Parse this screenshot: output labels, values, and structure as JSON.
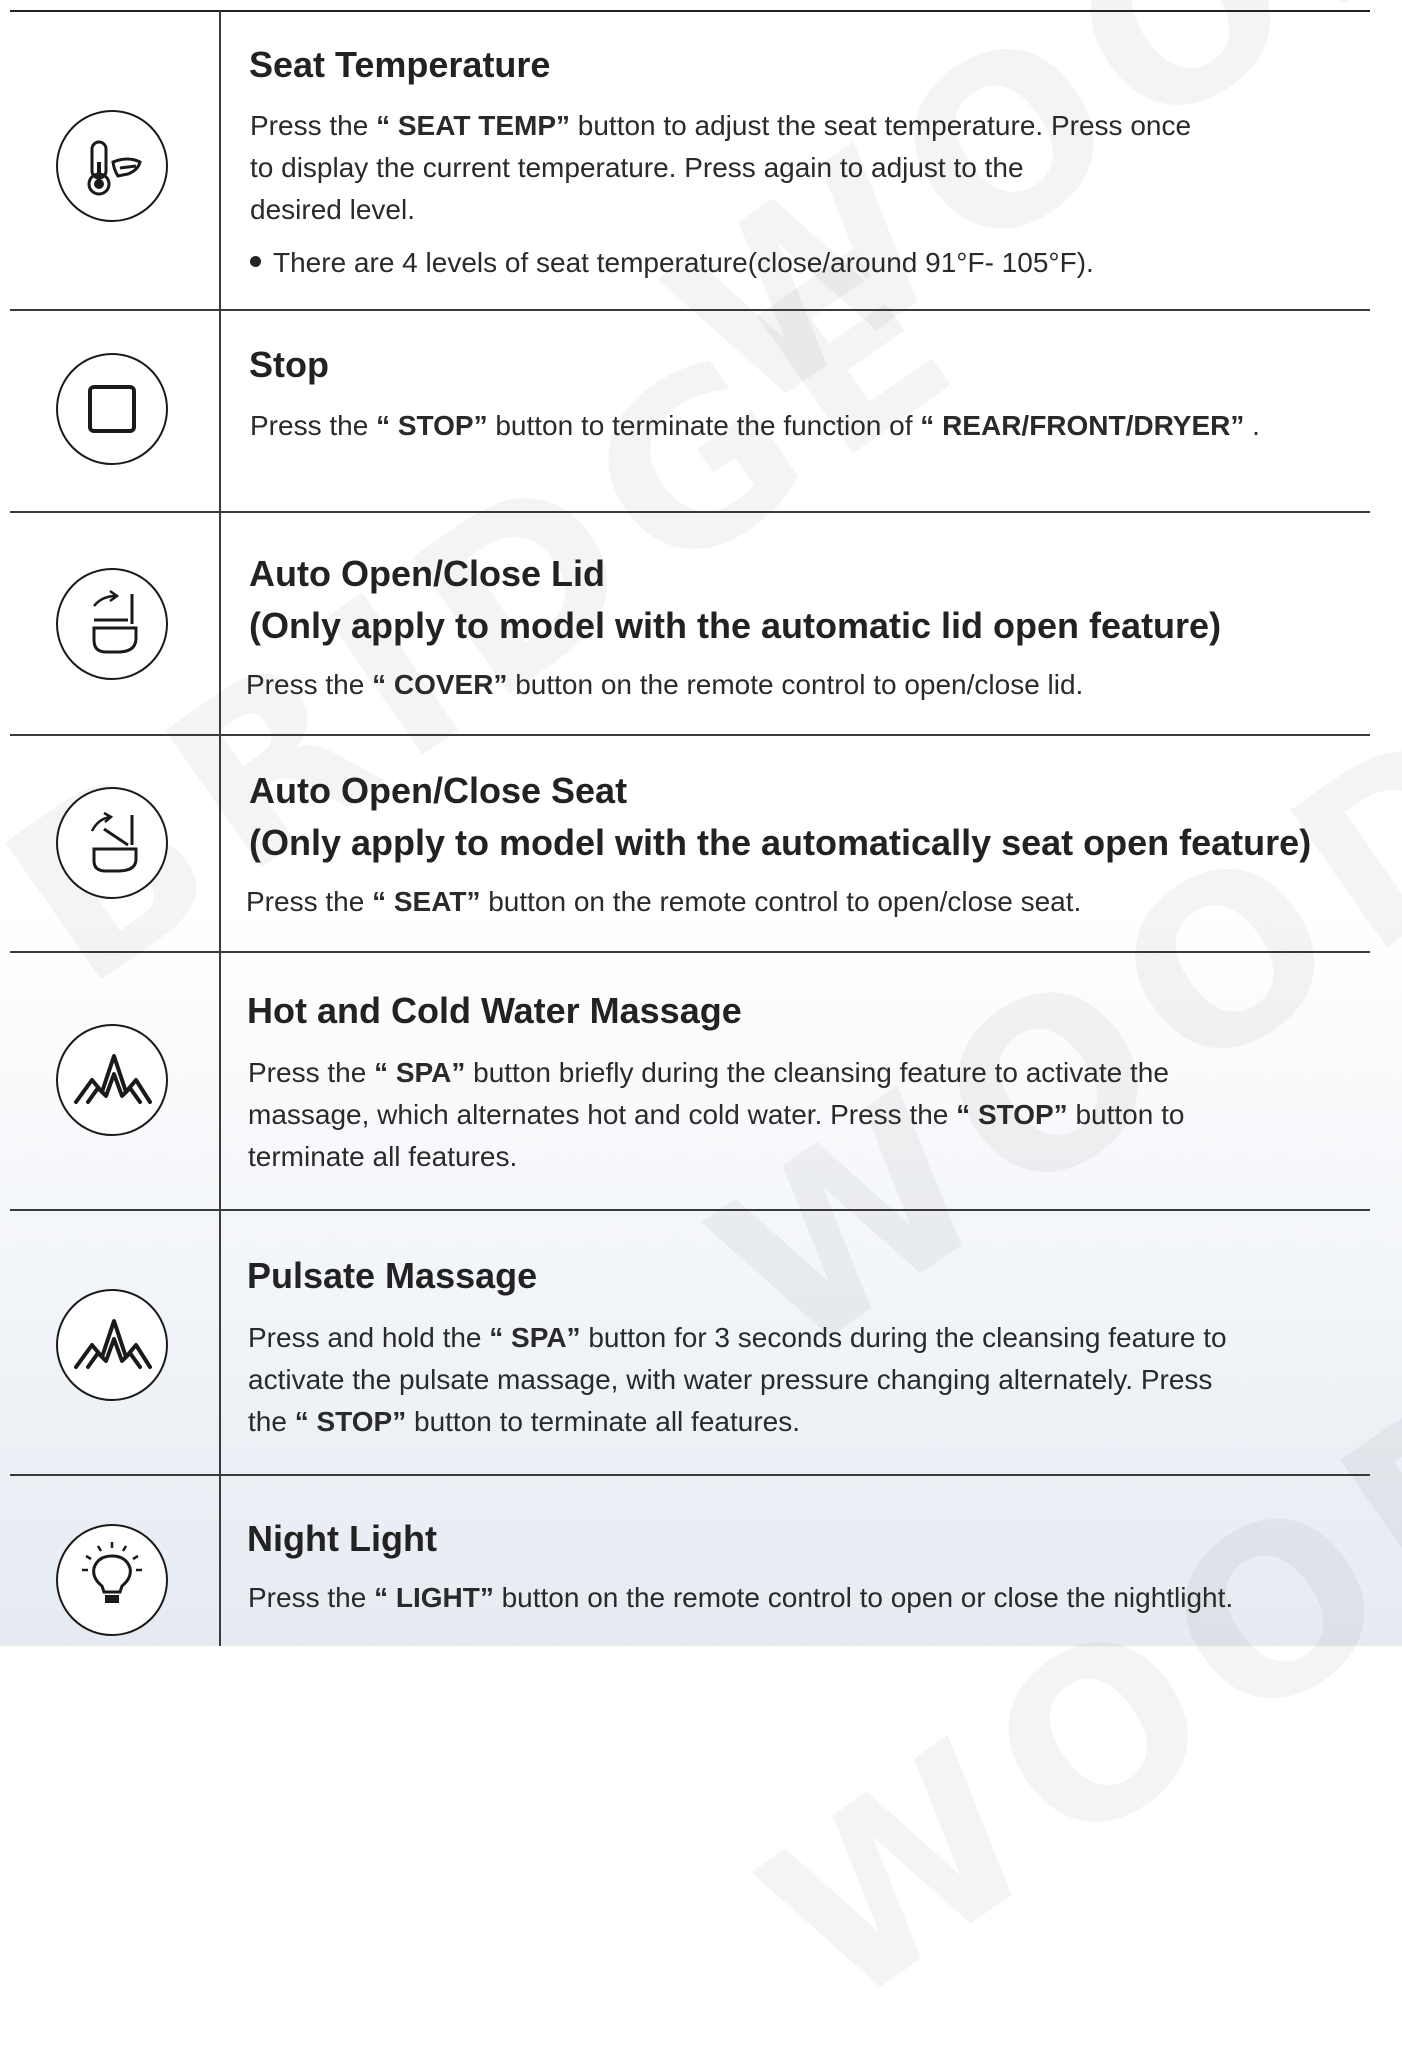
{
  "watermark": {
    "text_1": "WOOD",
    "text_2": "BRIDGE",
    "text_3": "WOODBRID",
    "text_4": "WOODBRID"
  },
  "sections": [
    {
      "icon": "thermometer-seat-icon",
      "title": "Seat Temperature",
      "lines": [
        [
          "Press the ",
          "“ SEAT TEMP”",
          " button to adjust the seat temperature. Press once"
        ],
        [
          "to display the current temperature. Press again to adjust to the"
        ],
        [
          "desired level."
        ]
      ],
      "bullet": "There are 4 levels of seat temperature(close/around 91°F- 105°F)."
    },
    {
      "icon": "stop-square-icon",
      "title": "Stop",
      "lines": [
        [
          "Press the ",
          "“ STOP”",
          " button to terminate the function of ",
          "“ REAR/FRONT/DRYER”",
          " ."
        ]
      ]
    },
    {
      "icon": "lid-open-close-icon",
      "title": "Auto Open/Close Lid",
      "subtitle": "(Only apply to model with the automatic lid open feature)",
      "lines": [
        [
          "Press the ",
          "“ COVER”",
          " button on the remote control to open/close lid."
        ]
      ]
    },
    {
      "icon": "seat-open-close-icon",
      "title": "Auto Open/Close Seat",
      "subtitle": "(Only apply to model with the automatically seat open feature)",
      "lines": [
        [
          "Press the ",
          "“ SEAT”",
          " button on the remote control to open/close seat."
        ]
      ]
    },
    {
      "icon": "spa-massage-icon",
      "title": "Hot and Cold Water Massage",
      "lines": [
        [
          "Press the ",
          "“ SPA”",
          " button briefly during the cleansing feature to activate the"
        ],
        [
          "massage, which alternates hot and cold water. Press the ",
          "“ STOP”",
          " button to"
        ],
        [
          "terminate all features."
        ]
      ]
    },
    {
      "icon": "spa-massage-icon",
      "title": "Pulsate Massage",
      "lines": [
        [
          "Press and hold the ",
          "“ SPA”",
          " button for 3 seconds during the cleansing feature to"
        ],
        [
          "activate the pulsate massage, with water pressure changing alternately. Press"
        ],
        [
          "the ",
          "“ STOP”",
          " button to terminate all features."
        ]
      ]
    },
    {
      "icon": "light-bulb-icon",
      "title": "Night Light",
      "lines": [
        [
          "Press the ",
          "“ LIGHT”",
          " button on the remote control to open or close the nightlight."
        ]
      ]
    }
  ]
}
